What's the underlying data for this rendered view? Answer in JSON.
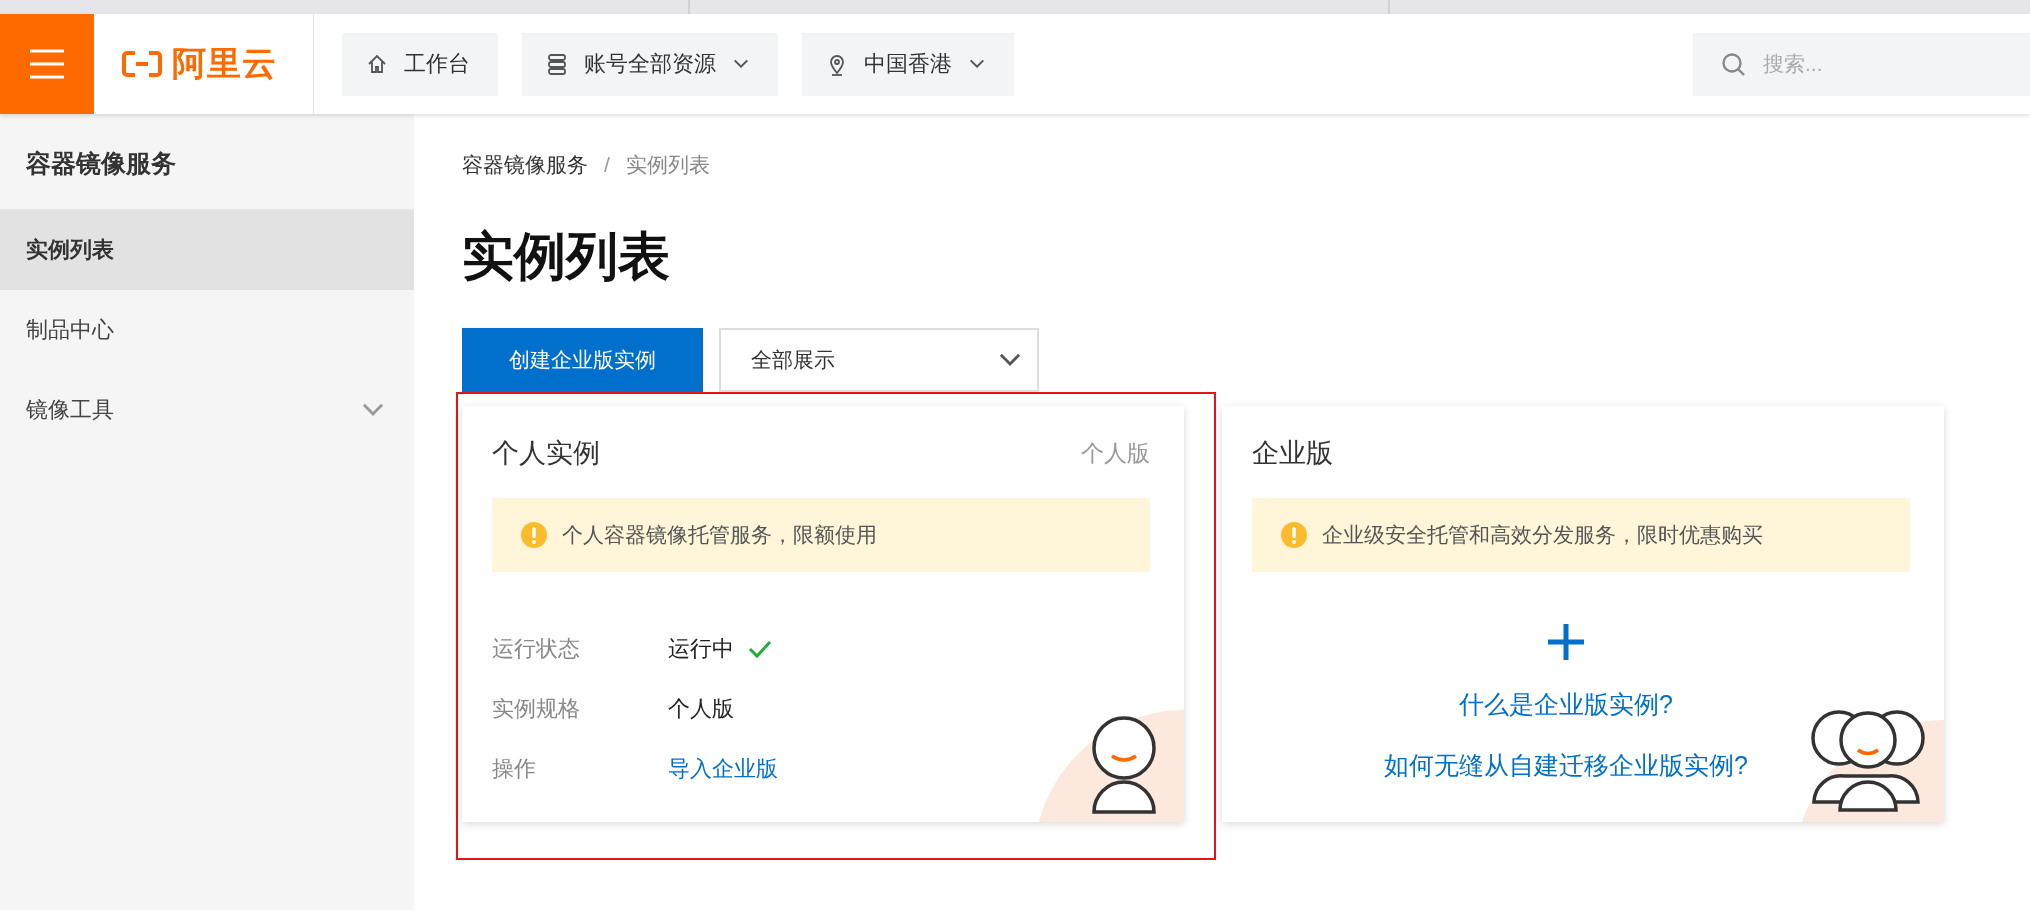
{
  "header": {
    "logo": "阿里云",
    "nav": [
      {
        "kind": "home",
        "label": "工作台",
        "dropdown": false
      },
      {
        "kind": "resources",
        "label": "账号全部资源",
        "dropdown": true
      },
      {
        "kind": "location",
        "label": "中国香港",
        "dropdown": true
      }
    ],
    "search": {
      "placeholder": "搜索..."
    }
  },
  "sidebar": {
    "title": "容器镜像服务",
    "items": [
      {
        "label": "实例列表",
        "selected": true,
        "expandable": false
      },
      {
        "label": "制品中心",
        "selected": false,
        "expandable": false
      },
      {
        "label": "镜像工具",
        "selected": false,
        "expandable": true
      }
    ]
  },
  "breadcrumb": {
    "items": [
      "容器镜像服务",
      "实例列表"
    ],
    "separator": "/"
  },
  "page_title": "实例列表",
  "toolbar": {
    "create_button": "创建企业版实例",
    "filter": {
      "value": "全部展示"
    }
  },
  "cards": [
    {
      "kind": "personal",
      "title": "个人实例",
      "edition": "个人版",
      "highlighted": true,
      "notice": "个人容器镜像托管服务，限额使用",
      "details": [
        {
          "kind": "status",
          "label": "运行状态",
          "value": "运行中",
          "ok": true
        },
        {
          "kind": "text",
          "label": "实例规格",
          "value": "个人版"
        },
        {
          "kind": "link",
          "label": "操作",
          "value": "导入企业版"
        }
      ]
    },
    {
      "kind": "enterprise",
      "title": "企业版",
      "highlighted": false,
      "notice": "企业级安全托管和高效分发服务，限时优惠购买",
      "links": [
        "什么是企业版实例?",
        "如何无缝从自建迁移企业版实例?"
      ]
    }
  ]
}
